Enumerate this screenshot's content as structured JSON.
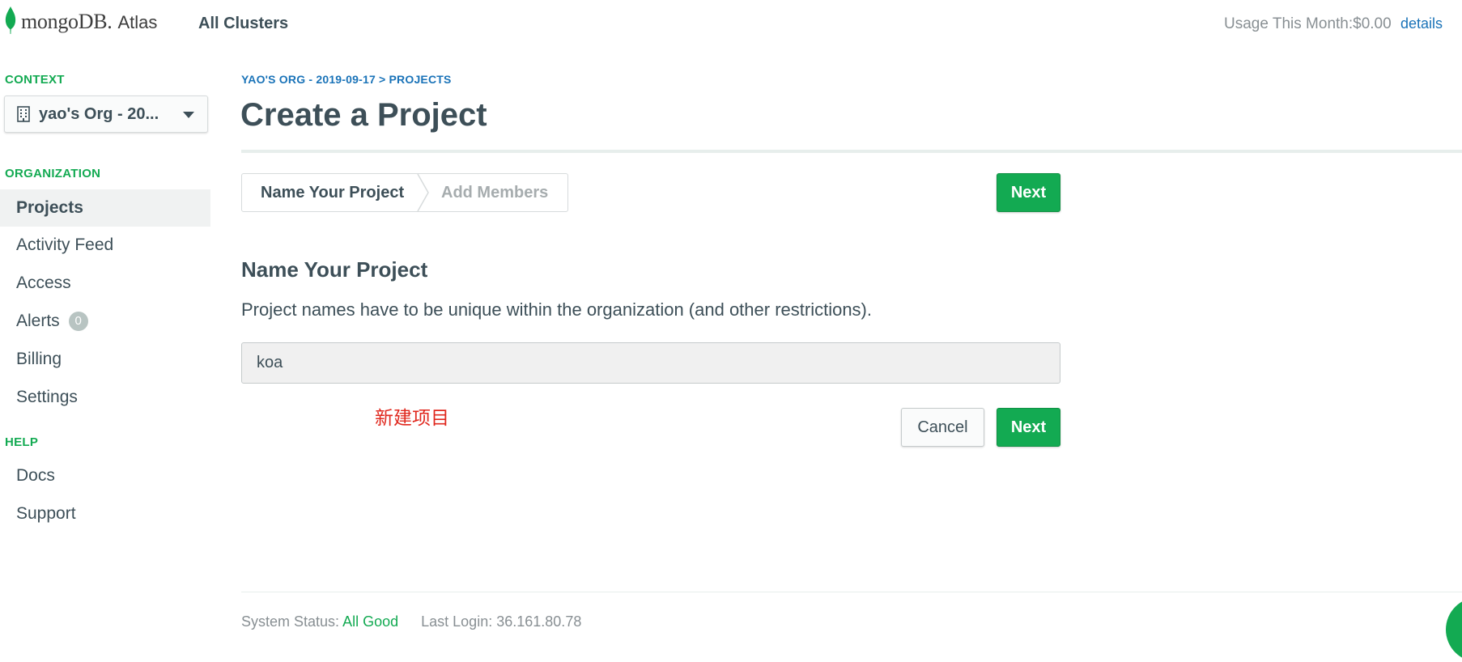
{
  "topbar": {
    "brand": "mongoDB.",
    "product": "Atlas",
    "all_clusters": "All Clusters",
    "usage_label": "Usage This Month:",
    "usage_value": "$0.00",
    "details_link": "details"
  },
  "sidebar": {
    "context_heading": "CONTEXT",
    "context_select": "yao's Org - 20...",
    "organization_heading": "ORGANIZATION",
    "org_items": [
      {
        "label": "Projects",
        "active": true
      },
      {
        "label": "Activity Feed"
      },
      {
        "label": "Access"
      },
      {
        "label": "Alerts",
        "badge": "0"
      },
      {
        "label": "Billing"
      },
      {
        "label": "Settings"
      }
    ],
    "help_heading": "HELP",
    "help_items": [
      {
        "label": "Docs"
      },
      {
        "label": "Support"
      }
    ]
  },
  "main": {
    "breadcrumb": "YAO'S ORG - 2019-09-17 > PROJECTS",
    "title": "Create a Project",
    "wizard_steps": [
      "Name Your Project",
      "Add Members"
    ],
    "next_label": "Next",
    "section_title": "Name Your Project",
    "section_desc": "Project names have to be unique within the organization (and other restrictions).",
    "project_name_value": "koa",
    "annotation": "新建项目",
    "cancel_label": "Cancel"
  },
  "footer": {
    "status_label": "System Status:",
    "status_value": "All Good",
    "last_login_label": "Last Login:",
    "last_login_value": "36.161.80.78"
  },
  "colors": {
    "brand_green": "#13aa52",
    "link_blue": "#1a73b8",
    "text": "#3d4f58",
    "annotation_red": "#e0281e"
  },
  "icons": [
    "mongodb-leaf-icon",
    "building-icon",
    "caret-down-icon",
    "chat-icon"
  ]
}
